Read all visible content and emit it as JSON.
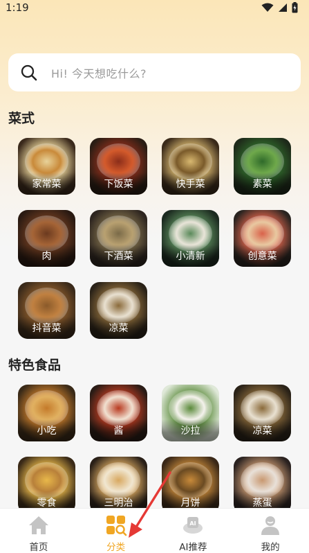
{
  "status": {
    "time": "1:19"
  },
  "search": {
    "placeholder": "Hi!  今天想吃什么?"
  },
  "sections": [
    {
      "title": "菜式",
      "items": [
        "家常菜",
        "下饭菜",
        "快手菜",
        "素菜",
        "肉",
        "下酒菜",
        "小清新",
        "创意菜",
        "抖音菜",
        "凉菜"
      ]
    },
    {
      "title": "特色食品",
      "items": [
        "小吃",
        "酱",
        "沙拉",
        "凉菜",
        "零食",
        "三明治",
        "月饼",
        "蒸蛋"
      ]
    }
  ],
  "nav": [
    {
      "label": "首页",
      "icon": "home-icon",
      "active": false
    },
    {
      "label": "分类",
      "icon": "category-icon",
      "active": true
    },
    {
      "label": "AI推荐",
      "icon": "ai-icon",
      "active": false
    },
    {
      "label": "我的",
      "icon": "profile-icon",
      "active": false
    }
  ],
  "colors": {
    "accent": "#f0a623",
    "nav_inactive": "#bfbfbf"
  }
}
